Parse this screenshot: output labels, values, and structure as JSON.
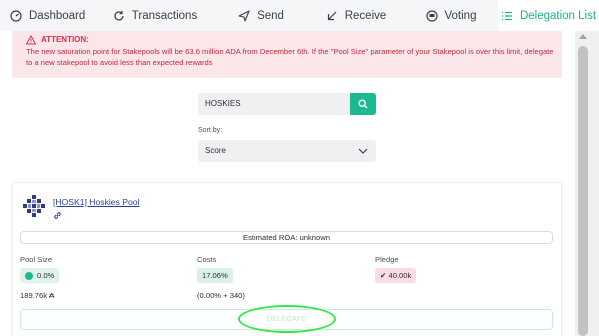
{
  "tabs": [
    {
      "label": "Dashboard",
      "icon": "dashboard-icon"
    },
    {
      "label": "Transactions",
      "icon": "transactions-icon"
    },
    {
      "label": "Send",
      "icon": "send-icon"
    },
    {
      "label": "Receive",
      "icon": "receive-icon"
    },
    {
      "label": "Voting",
      "icon": "voting-icon"
    },
    {
      "label": "Delegation List",
      "icon": "list-icon",
      "active": true
    }
  ],
  "alert": {
    "title": "ATTENTION:",
    "message": "The new saturation point for Stakepools will be 63.6 million ADA from December 6th. If the \"Pool Size\" parameter of your Stakepool is over this limit, delegate to a new stakepool to avoid less than expected rewards"
  },
  "search": {
    "value": "HOSKIES"
  },
  "sort": {
    "label": "Sort by:",
    "selected": "Score"
  },
  "pool": {
    "name": "[HOSK1] Hoskies Pool",
    "roa": "Estimated ROA: unknown",
    "pool_size_label": "Pool Size",
    "pool_size_value": "0.0%",
    "pool_size_sub": "189.76k ₳",
    "costs_label": "Costs",
    "costs_value": "17.06%",
    "costs_sub": "(0.00% + 340)",
    "pledge_label": "Pledge",
    "pledge_value": "✔ 40.00k",
    "delegate_label": "DELEGATE"
  },
  "colors": {
    "accent": "#17b28c",
    "alert_bg": "#fbe7e9",
    "alert_text": "#c5283f",
    "highlight_circle": "#37e64c"
  }
}
